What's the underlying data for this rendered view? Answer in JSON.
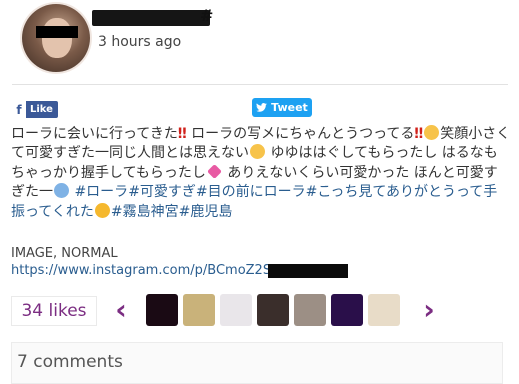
{
  "post": {
    "username_suffix": "#",
    "timestamp": "3 hours ago"
  },
  "share": {
    "like_label": "Like",
    "tweet_label": "Tweet"
  },
  "caption": {
    "part1": "ローラに会いに行ってきた",
    "bangs1": "‼",
    "part2": " ローラの写メにちゃんとうつってる",
    "bangs2": "‼",
    "part3": "笑顔小さくて可愛すぎた一同じ人間とは思えない",
    "part4": " ゆゆははぐしてもらったし はるなもちゃっかり握手してもらったし",
    "part5": " ありえないくらい可愛かった ほんと可愛すぎた一",
    "tag1": "#ローラ",
    "tag2": "#可愛すぎ",
    "tag3": "#目の前にローラ",
    "tag4": "#こっち見てありがとうって手振ってくれた",
    "tag5": "#霧島神宮",
    "tag6": "#鹿児島"
  },
  "media": {
    "type_label": "IMAGE, NORMAL",
    "link": "https://www.instagram.com/p/BCmoZ2S"
  },
  "likes": {
    "label": "34 likes"
  },
  "carousel": {
    "prev_glyph": "‹",
    "next_glyph": "›",
    "thumb_colors": [
      "#1a0a14",
      "#c9b27a",
      "#e9e6ea",
      "#3a2e2b",
      "#9c8f85",
      "#2a0f4a",
      "#e8dcc8"
    ]
  },
  "comments": {
    "label": "7 comments"
  },
  "colors": {
    "accent": "#7b2d82",
    "link": "#2a5d8f",
    "facebook": "#3b5998",
    "twitter": "#1da1f2"
  }
}
